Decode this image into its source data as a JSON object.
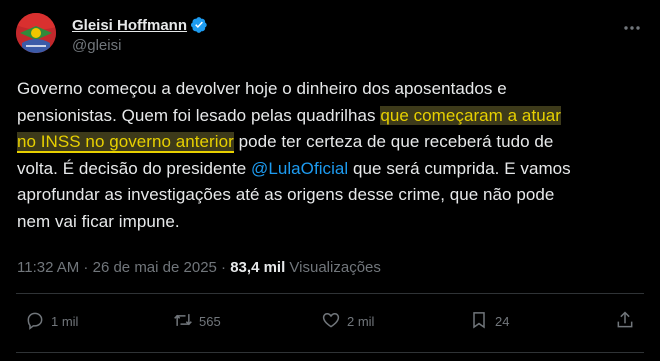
{
  "author": {
    "display_name": "Gleisi Hoffmann",
    "handle": "@gleisi"
  },
  "tweet": {
    "line1": "Governo começou a devolver hoje o dinheiro dos aposentados e",
    "line2_a": "pensionistas. Quem foi lesado pelas quadrilhas ",
    "line2_hl": "que começaram a atuar",
    "line3_hl": "no INSS no governo anterior",
    "line3_b": " pode ter certeza de que receberá tudo de",
    "line4_a": "volta. É decisão do presidente ",
    "line4_mention": "@LulaOficial",
    "line4_b": " que será cumprida. E vamos",
    "line5": "aprofundar as investigações até as origens desse crime, que não pode",
    "line6": "nem vai ficar impune."
  },
  "meta": {
    "time": "11:32 AM",
    "separator": " · ",
    "date": "26 de mai de 2025",
    "views_count": "83,4 mil",
    "views_label": " Visualizações"
  },
  "actions": {
    "replies": "1 mil",
    "reposts": "565",
    "likes": "2 mil",
    "bookmarks": "24"
  },
  "colors": {
    "background": "#000000",
    "text": "#e7e9ea",
    "muted": "#71767b",
    "link": "#1d9bf0",
    "highlight": "#e7d000",
    "verified": "#1d9bf0"
  },
  "icons": {
    "verified": "verified-badge-icon",
    "more": "more-dots-icon",
    "reply": "reply-icon",
    "repost": "repost-icon",
    "like": "heart-icon",
    "bookmark": "bookmark-icon",
    "share": "share-icon"
  }
}
